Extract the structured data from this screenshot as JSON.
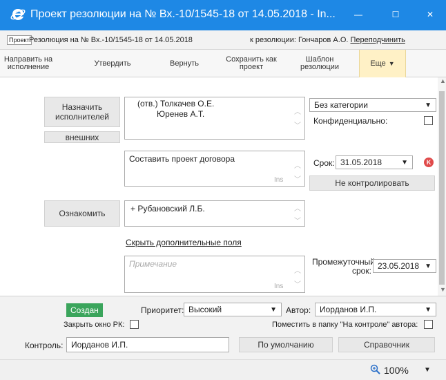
{
  "window": {
    "title": "Проект резолюции на № Вх.-10/1545-18 от 14.05.2018 - In...",
    "minimize": "—",
    "maximize": "☐",
    "close": "✕"
  },
  "info": {
    "tag": "Проект",
    "left": "Резолюция на № Вх.-10/1545-18 от 14.05.2018",
    "right_prefix": "к резолюции: Гончаров А.О.",
    "right_link": "Переподчинить"
  },
  "toolbar": {
    "send": "Направить на исполнение",
    "approve": "Утвердить",
    "return": "Вернуть",
    "save_project": "Сохранить как проект",
    "template": "Шаблон резолюции",
    "more": "Еще"
  },
  "form": {
    "assign_btn": "Назначить исполнителей",
    "external_btn": "внешних",
    "executor1": "(отв.) Толкачев О.Е.",
    "executor2": "Юренев А.Т.",
    "category": "Без категории",
    "confidential": "Конфиденциально:",
    "task_text": "Составить проект договора",
    "ins": "Ins",
    "deadline_label": "Срок:",
    "deadline_value": "31.05.2018",
    "no_control_btn": "Не контролировать",
    "familiarize_btn": "Ознакомить",
    "familiarize_person": "+  Рубановский Л.Б.",
    "hide_fields_link": "Скрыть дополнительные поля",
    "note_placeholder": "Примечание",
    "interim_label_1": "Промежуточный",
    "interim_label_2": "срок:",
    "interim_value": "23.05.2018"
  },
  "bottom": {
    "status_badge": "Создан",
    "priority_label": "Приоритет:",
    "priority_value": "Высокий",
    "author_label": "Автор:",
    "author_value": "Иорданов И.П.",
    "close_rk_label": "Закрыть окно РК:",
    "put_folder_label": "Поместить в папку \"На контроле\" автора:",
    "control_label": "Контроль:",
    "control_value": "Иорданов И.П.",
    "default_btn": "По умолчанию",
    "reference_btn": "Справочник"
  },
  "statusbar": {
    "zoom": "100%"
  },
  "colors": {
    "titlebar": "#1e88e5",
    "badge": "#3ba55c",
    "remove_icon": "#e04a4a",
    "more_bg": "#fff1c6"
  }
}
